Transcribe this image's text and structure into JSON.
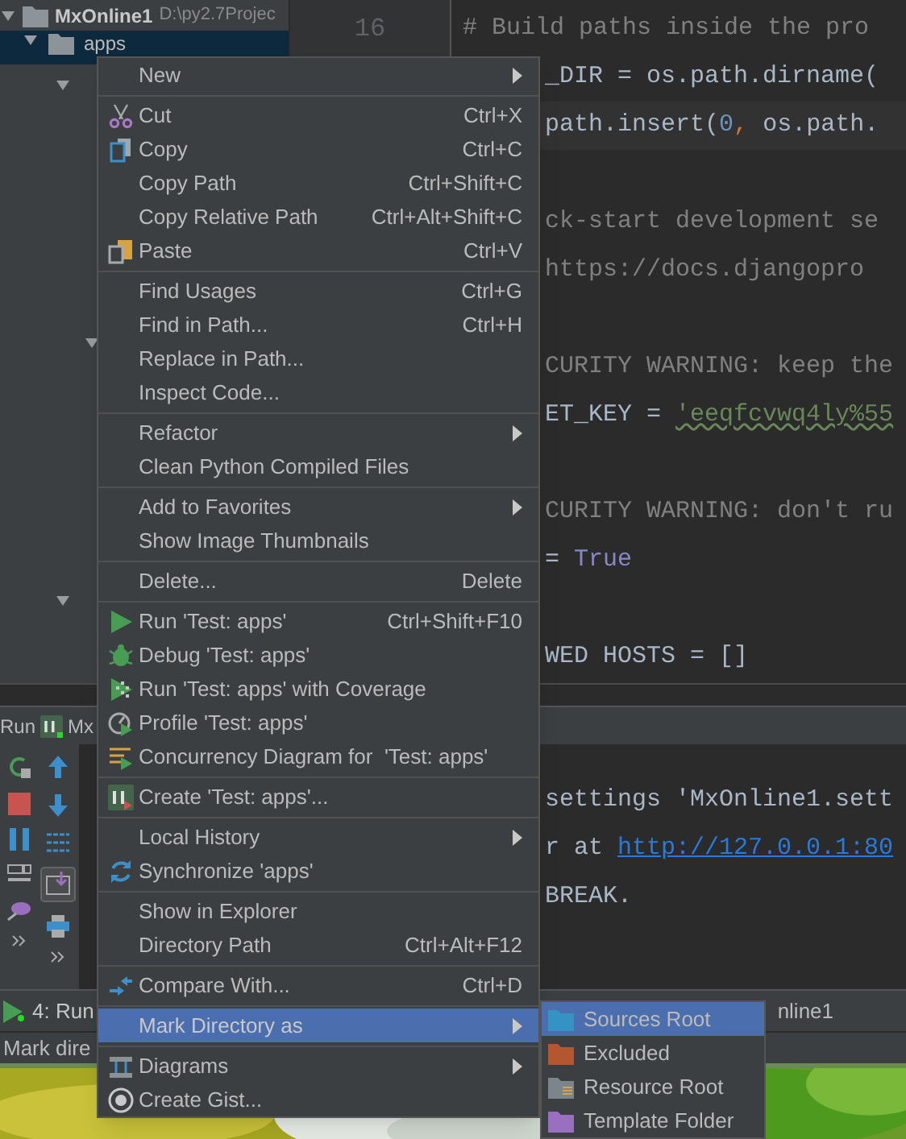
{
  "project": {
    "root_name": "MxOnline1",
    "root_path": "D:\\py2.7Projec",
    "folder": {
      "name": "apps",
      "selected": true
    }
  },
  "editor": {
    "line_number": "16",
    "lines": [
      {
        "segments": [
          {
            "kind": "comment",
            "text": "# Build paths inside the pro"
          }
        ]
      },
      {
        "segments": [
          {
            "kind": "plain",
            "text": "_DIR = os.path.dirname("
          }
        ]
      },
      {
        "segments": [
          {
            "kind": "plain",
            "text": "path.insert("
          },
          {
            "kind": "number",
            "text": "0"
          },
          {
            "kind": "punct",
            "text": ", "
          },
          {
            "kind": "plain",
            "text": "os.path."
          }
        ]
      },
      {
        "segments": [
          {
            "kind": "comment",
            "text": "ck-start development se"
          }
        ]
      },
      {
        "segments": [
          {
            "kind": "comment",
            "text": "https://docs.djangopro"
          }
        ]
      },
      {
        "segments": [
          {
            "kind": "comment",
            "text": "CURITY WARNING: keep the"
          }
        ]
      },
      {
        "segments": [
          {
            "kind": "plain",
            "text": "ET_KEY = "
          },
          {
            "kind": "string",
            "text": "'eeqfcvwq4ly%55"
          }
        ]
      },
      {
        "segments": [
          {
            "kind": "comment",
            "text": "CURITY WARNING: don't ru"
          }
        ]
      },
      {
        "segments": [
          {
            "kind": "plain",
            "text": "= "
          },
          {
            "kind": "keyword",
            "text": "True"
          }
        ]
      },
      {
        "segments": [
          {
            "kind": "plain",
            "text": "WED HOSTS = []"
          }
        ]
      }
    ]
  },
  "run_panel": {
    "tab_label": "Run",
    "tab_name": "Mx",
    "console": [
      {
        "segments": [
          {
            "kind": "plain",
            "text": "settings 'MxOnline1.sett"
          }
        ]
      },
      {
        "segments": [
          {
            "kind": "plain",
            "text": "r at "
          },
          {
            "kind": "link",
            "text": "http://127.0.0.1:80"
          }
        ]
      },
      {
        "segments": [
          {
            "kind": "plain",
            "text": "BREAK."
          }
        ]
      }
    ]
  },
  "tool_window_bar": {
    "tab": "4: Run",
    "tab_right": "nline1"
  },
  "status_bar": {
    "text": "Mark dire"
  },
  "context_menu": {
    "items": [
      {
        "kind": "item",
        "label": "New",
        "submenu": true,
        "selected": false
      },
      {
        "kind": "separator"
      },
      {
        "kind": "item",
        "label": "Cut",
        "shortcut": "Ctrl+X",
        "selected": false
      },
      {
        "kind": "item",
        "label": "Copy",
        "shortcut": "Ctrl+C",
        "selected": false
      },
      {
        "kind": "item",
        "label": "Copy Path",
        "shortcut": "Ctrl+Shift+C",
        "selected": false
      },
      {
        "kind": "item",
        "label": "Copy Relative Path",
        "shortcut": "Ctrl+Alt+Shift+C",
        "selected": false
      },
      {
        "kind": "item",
        "label": "Paste",
        "shortcut": "Ctrl+V",
        "selected": false
      },
      {
        "kind": "separator"
      },
      {
        "kind": "item",
        "label": "Find Usages",
        "shortcut": "Ctrl+G",
        "selected": false
      },
      {
        "kind": "item",
        "label": "Find in Path...",
        "shortcut": "Ctrl+H",
        "selected": false
      },
      {
        "kind": "item",
        "label": "Replace in Path...",
        "selected": false
      },
      {
        "kind": "item",
        "label": "Inspect Code...",
        "selected": false
      },
      {
        "kind": "separator"
      },
      {
        "kind": "item",
        "label": "Refactor",
        "submenu": true,
        "selected": false
      },
      {
        "kind": "item",
        "label": "Clean Python Compiled Files",
        "selected": false
      },
      {
        "kind": "separator"
      },
      {
        "kind": "item",
        "label": "Add to Favorites",
        "submenu": true,
        "selected": false
      },
      {
        "kind": "item",
        "label": "Show Image Thumbnails",
        "selected": false
      },
      {
        "kind": "separator"
      },
      {
        "kind": "item",
        "label": "Delete...",
        "shortcut": "Delete",
        "selected": false
      },
      {
        "kind": "separator"
      },
      {
        "kind": "item",
        "label": "Run 'Test: apps'",
        "shortcut": "Ctrl+Shift+F10",
        "selected": false
      },
      {
        "kind": "item",
        "label": "Debug 'Test: apps'",
        "selected": false
      },
      {
        "kind": "item",
        "label": "Run 'Test: apps' with Coverage",
        "selected": false
      },
      {
        "kind": "item",
        "label": "Profile 'Test: apps'",
        "selected": false
      },
      {
        "kind": "item",
        "label": "Concurrency Diagram for  'Test: apps'",
        "selected": false
      },
      {
        "kind": "separator"
      },
      {
        "kind": "item",
        "label": "Create 'Test: apps'...",
        "selected": false
      },
      {
        "kind": "separator"
      },
      {
        "kind": "item",
        "label": "Local History",
        "submenu": true,
        "selected": false
      },
      {
        "kind": "item",
        "label": "Synchronize 'apps'",
        "selected": false
      },
      {
        "kind": "separator"
      },
      {
        "kind": "item",
        "label": "Show in Explorer",
        "selected": false
      },
      {
        "kind": "item",
        "label": "Directory Path",
        "shortcut": "Ctrl+Alt+F12",
        "selected": false
      },
      {
        "kind": "separator"
      },
      {
        "kind": "item",
        "label": "Compare With...",
        "shortcut": "Ctrl+D",
        "selected": false
      },
      {
        "kind": "separator"
      },
      {
        "kind": "item",
        "label": "Mark Directory as",
        "submenu": true,
        "selected": true
      },
      {
        "kind": "separator"
      },
      {
        "kind": "item",
        "label": "Diagrams",
        "submenu": true,
        "selected": false
      },
      {
        "kind": "item",
        "label": "Create Gist...",
        "selected": false
      }
    ]
  },
  "submenu": {
    "items": [
      {
        "label": "Sources Root",
        "color": "#3592c4",
        "selected": true
      },
      {
        "label": "Excluded",
        "color": "#b4562f",
        "selected": false
      },
      {
        "label": "Resource Root",
        "color": "#7c858c",
        "selected": false
      },
      {
        "label": "Template Folder",
        "color": "#9a6fbf",
        "selected": false
      }
    ]
  }
}
